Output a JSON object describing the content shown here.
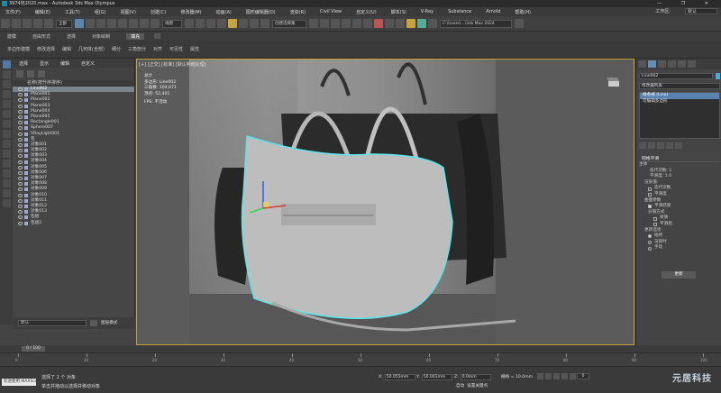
{
  "titlebar": {
    "title": "3974包2020.max - Autodesk 3ds Max Olympus",
    "controls": "— ❐ ✕"
  },
  "menubar": {
    "items": [
      "文件(F)",
      "编辑(E)",
      "工具(T)",
      "组(G)",
      "视图(V)",
      "创建(C)",
      "修改器(M)",
      "动画(A)",
      "图形编辑器(D)",
      "渲染(R)",
      "Civil View",
      "自定义(U)",
      "脚本(S)",
      "V-Ray",
      "Substance",
      "Arnold",
      "帮助(H)"
    ],
    "workspace_label": "工作区:",
    "workspace_value": "默认"
  },
  "toolbar": {
    "view_dropdown": "视图",
    "selection_set": "创建选择集",
    "path": "C:\\Users\\...\\3ds Max 2024",
    "unit_dropdown": "全部"
  },
  "ribbon": {
    "tabs": [
      "建模",
      "自由形式",
      "选择",
      "对象绘制",
      "填充"
    ],
    "active_tab": "多边形建模",
    "row2": [
      "多边形建模",
      "修改选择",
      "编辑",
      "几何体(全部)",
      "细分",
      "三角剖分",
      "对齐",
      "可见性",
      "属性"
    ]
  },
  "explorer": {
    "tabs": [
      "选择",
      "显示",
      "编辑",
      "自定义"
    ],
    "header": "名称(按升序排序)",
    "items": [
      "Line002",
      "Plane001",
      "Plane002",
      "Plane003",
      "Plane004",
      "Plane005",
      "Rectangle001",
      "Sphere007",
      "VRayLight001",
      "包",
      "对象001",
      "对象002",
      "对象003",
      "对象004",
      "对象005",
      "对象006",
      "对象007",
      "对象008",
      "对象009",
      "对象010",
      "对象011",
      "对象012",
      "对象013",
      "包组",
      "包组2"
    ],
    "selected_index": 0,
    "layer_value": "默认",
    "layer_label": "图层模式"
  },
  "viewport": {
    "label": "[+] [正交] [标准] [默认明暗处理]",
    "stats_title": "总计",
    "stats": [
      {
        "label": "多边形:",
        "value": "Line002"
      },
      {
        "label": "三角数:",
        "value": "104,671"
      },
      {
        "label": "顶点:",
        "value": "52,401"
      }
    ],
    "fps_label": "FPS:",
    "fps_value": "不活动"
  },
  "command_panel": {
    "object_name": "Line002",
    "modifier_list": "修改器列表",
    "stack": [
      "样条线 (Line)",
      "可编辑多边形"
    ],
    "selected_stack": 0,
    "rollout_title": "网格平滑",
    "section_main": "主体",
    "iterations_label": "迭代次数:",
    "iterations_value": "1",
    "smoothness_label": "平滑度:",
    "smoothness_value": "1.0",
    "render_label": "渲染值:",
    "checks": [
      "迭代次数",
      "平滑度"
    ],
    "update_options_title": "更新选项",
    "radio_options": [
      "始终",
      "渲染时",
      "手动"
    ],
    "update_button": "更新",
    "surface_title": "曲面参数",
    "smooth_result": "平滑结果",
    "separate_label": "分隔方式",
    "materials": "材质",
    "smoothing_groups": "平滑组"
  },
  "timeline": {
    "frame_display": "0 / 100",
    "ticks": [
      "0",
      "10",
      "20",
      "30",
      "40",
      "50",
      "60",
      "70",
      "80",
      "90",
      "100"
    ]
  },
  "status": {
    "maxscript": "欢迎使用 MAXScript",
    "line1": "选择了 1 个 对象",
    "line2": "单击并拖动以选择并移动对象",
    "x_label": "X:",
    "x_value": "50.055mm",
    "y_label": "Y:",
    "y_value": "50.001mm",
    "z_label": "Z:",
    "z_value": "0.0mm",
    "grid": "栅格 = 10.0mm",
    "autokey": "自动",
    "setkey": "设置关键点",
    "frame": "0",
    "watermark": "元居科技"
  }
}
